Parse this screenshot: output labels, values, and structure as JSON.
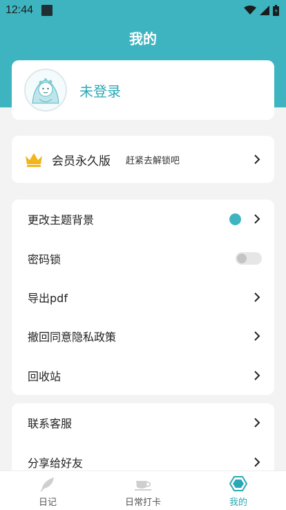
{
  "status": {
    "time": "12:44"
  },
  "header": {
    "title": "我的"
  },
  "profile": {
    "login_text": "未登录"
  },
  "vip": {
    "title": "会员永久版",
    "subtitle": "赶紧去解锁吧"
  },
  "settings": {
    "items": [
      {
        "label": "更改主题背景"
      },
      {
        "label": "密码锁"
      },
      {
        "label": "导出pdf"
      },
      {
        "label": "撤回同意隐私政策"
      },
      {
        "label": "回收站"
      }
    ],
    "theme_color": "#3eb4c0"
  },
  "more": {
    "items": [
      {
        "label": "联系客服"
      },
      {
        "label": "分享给好友"
      }
    ]
  },
  "nav": {
    "items": [
      {
        "label": "日记",
        "icon": "feather-icon"
      },
      {
        "label": "日常打卡",
        "icon": "cup-icon"
      },
      {
        "label": "我的",
        "icon": "hexagon-icon"
      }
    ],
    "active_color": "#2aa8b6"
  }
}
